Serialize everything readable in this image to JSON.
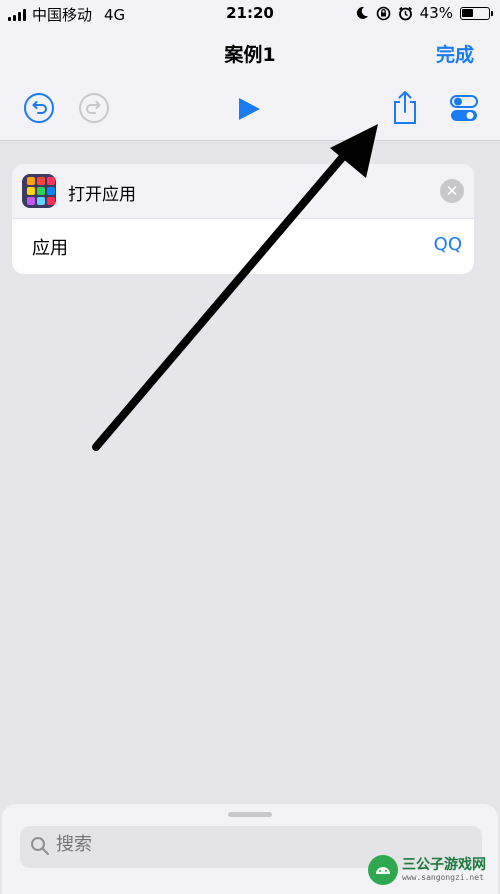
{
  "status_bar": {
    "carrier": "中国移动",
    "network": "4G",
    "time": "21:20",
    "battery": "43%",
    "battery_level": 0.43
  },
  "header": {
    "title": "案例1",
    "done_label": "完成"
  },
  "toolbar": {
    "icons": [
      "undo-icon",
      "redo-icon",
      "play-icon",
      "share-icon",
      "settings-toggle-icon"
    ]
  },
  "action_card": {
    "title": "打开应用",
    "row_label": "应用",
    "row_value": "QQ"
  },
  "search": {
    "placeholder": "搜索"
  },
  "watermark": {
    "title": "三公子游戏网",
    "url": "www.sangongzi.net"
  },
  "colors": {
    "accent": "#1a7cf5",
    "background": "#e5e5ea",
    "header": "#f2f2f7"
  }
}
